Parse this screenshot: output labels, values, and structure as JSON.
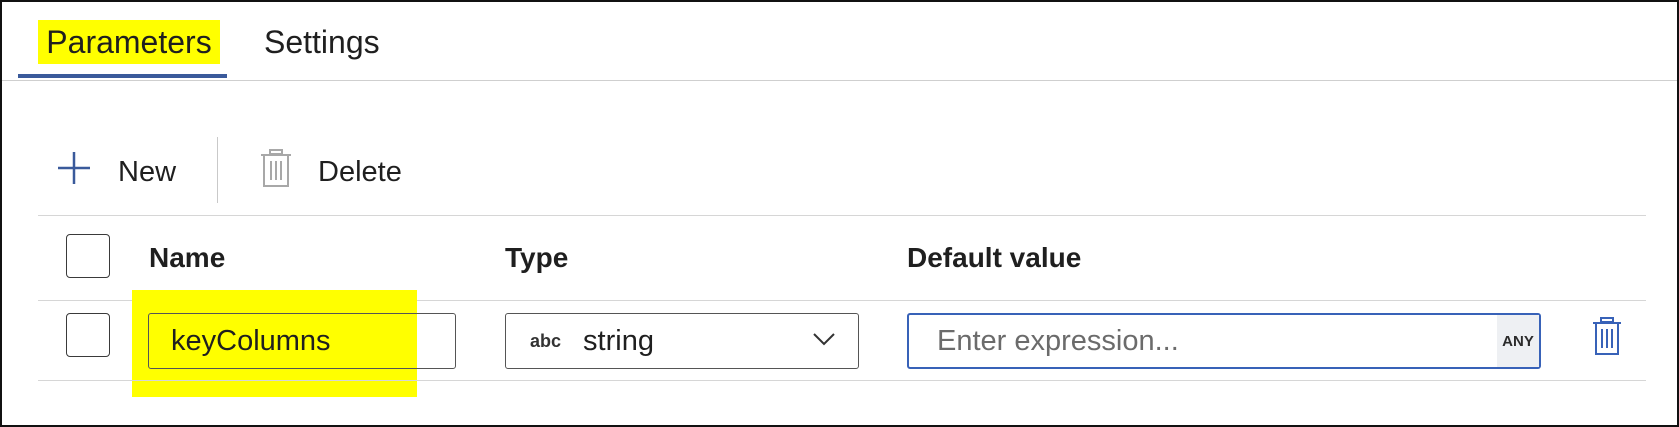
{
  "tabs": [
    {
      "label": "Parameters",
      "active": true
    },
    {
      "label": "Settings",
      "active": false
    }
  ],
  "toolbar": {
    "new_label": "New",
    "delete_label": "Delete"
  },
  "columns": {
    "name": "Name",
    "type": "Type",
    "default_value": "Default value"
  },
  "rows": [
    {
      "name": "keyColumns",
      "type_badge": "abc",
      "type": "string",
      "default_value": "",
      "default_placeholder": "Enter expression...",
      "expression_badge": "ANY"
    }
  ],
  "colors": {
    "highlight": "#ffff00",
    "accent": "#3a5a9b",
    "focus_border": "#3862b8",
    "delete_icon": "#3862b8"
  },
  "icons": {
    "new": "plus-icon",
    "delete": "trash-icon",
    "dropdown": "chevron-down-icon",
    "row_delete": "trash-icon"
  }
}
